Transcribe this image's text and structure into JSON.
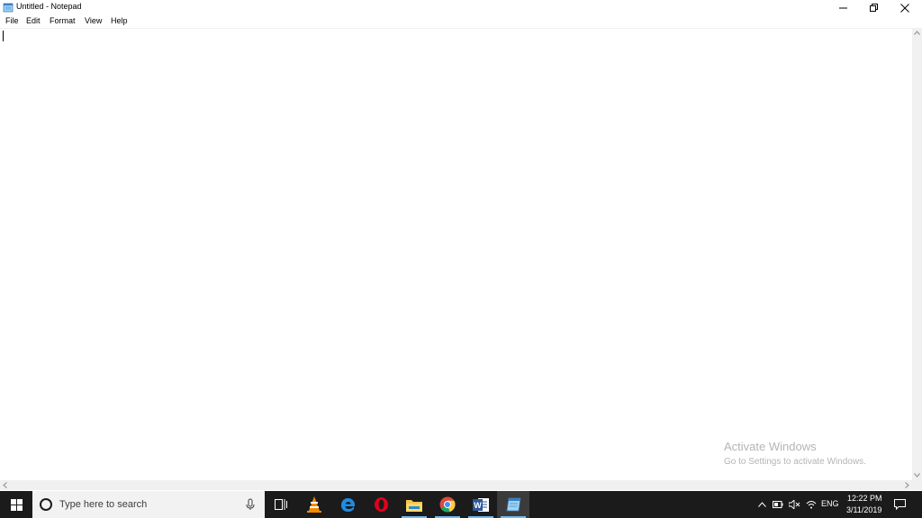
{
  "window": {
    "title": "Untitled - Notepad",
    "icon": "notepad-icon"
  },
  "menu": {
    "items": [
      "File",
      "Edit",
      "Format",
      "View",
      "Help"
    ]
  },
  "editor": {
    "content": ""
  },
  "watermark": {
    "title": "Activate Windows",
    "subtitle": "Go to Settings to activate Windows."
  },
  "taskbar": {
    "search_placeholder": "Type here to search",
    "apps": [
      "task-view-icon",
      "vlc-icon",
      "edge-icon",
      "opera-icon",
      "file-explorer-icon",
      "chrome-icon",
      "word-icon",
      "notepad-icon"
    ],
    "tray": {
      "language": "ENG",
      "time": "12:22 PM",
      "date": "3/11/2019"
    }
  },
  "colors": {
    "taskbar_bg": "#1b1b1b",
    "running_indicator": "#76b9ed",
    "watermark_text": "#b4b4b4"
  }
}
